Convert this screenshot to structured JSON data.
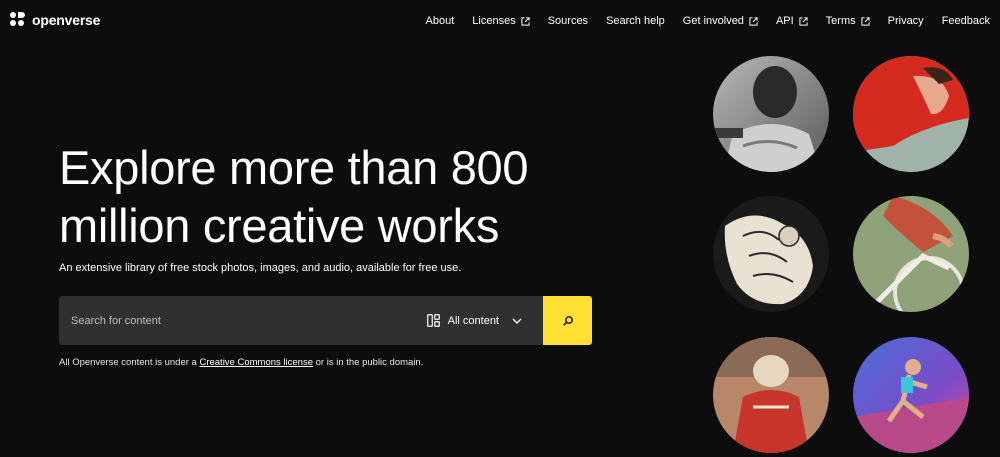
{
  "brand": {
    "name": "openverse"
  },
  "nav": {
    "items": [
      {
        "label": "About",
        "external": false
      },
      {
        "label": "Licenses",
        "external": true
      },
      {
        "label": "Sources",
        "external": false
      },
      {
        "label": "Search help",
        "external": false
      },
      {
        "label": "Get involved",
        "external": true
      },
      {
        "label": "API",
        "external": true
      },
      {
        "label": "Terms",
        "external": true
      },
      {
        "label": "Privacy",
        "external": false
      },
      {
        "label": "Feedback",
        "external": false
      }
    ]
  },
  "hero": {
    "headline": "Explore more than 800 million creative works",
    "subtitle": "An extensive library of free stock photos, images, and audio, available for free use."
  },
  "search": {
    "placeholder": "Search for content",
    "content_type": "All content"
  },
  "license_note": {
    "prefix": "All Openverse content is under a ",
    "link": "Creative Commons license",
    "suffix": " or is in the public domain."
  },
  "colors": {
    "background": "#0d0d0d",
    "accent": "#ffe033",
    "search_bg": "#303030"
  },
  "icons": [
    "brand-logo-icon",
    "external-link-icon",
    "content-grid-icon",
    "chevron-down-icon",
    "search-icon"
  ]
}
